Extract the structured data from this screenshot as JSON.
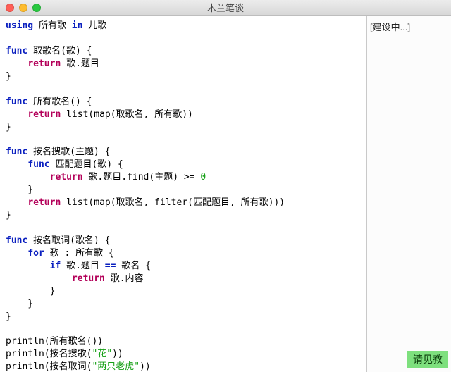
{
  "window": {
    "title": "木兰笔谈"
  },
  "sidebar": {
    "status": "[建设中...]",
    "footer": "请见教"
  },
  "code": {
    "line01_kw_using": "using",
    "line01_mid": " 所有歌 ",
    "line01_kw_in": "in",
    "line01_end": " 儿歌",
    "line03_kw_func": "func",
    "line03_sig": " 取歌名(歌) {",
    "line04_indent": "    ",
    "line04_ret": "return",
    "line04_body": " 歌.题目",
    "line05": "}",
    "line07_kw_func": "func",
    "line07_sig": " 所有歌名() {",
    "line08_indent": "    ",
    "line08_ret": "return",
    "line08_body": " list(map(取歌名, 所有歌))",
    "line09": "}",
    "line11_kw_func": "func",
    "line11_sig": " 按名搜歌(主题) {",
    "line12_indent": "    ",
    "line12_kw_func": "func",
    "line12_sig": " 匹配题目(歌) {",
    "line13_indent": "        ",
    "line13_ret": "return",
    "line13_body": " 歌.题目.find(主题) >= ",
    "line13_num": "0",
    "line14": "    }",
    "line15_indent": "    ",
    "line15_ret": "return",
    "line15_body": " list(map(取歌名, filter(匹配题目, 所有歌)))",
    "line16": "}",
    "line18_kw_func": "func",
    "line18_sig": " 按名取词(歌名) {",
    "line19_indent": "    ",
    "line19_for": "for",
    "line19_body": " 歌 : 所有歌 {",
    "line20_indent": "        ",
    "line20_if": "if",
    "line20_body1": " 歌.题目 ",
    "line20_eq": "==",
    "line20_body2": " 歌名 {",
    "line21_indent": "            ",
    "line21_ret": "return",
    "line21_body": " 歌.内容",
    "line22": "        }",
    "line23": "    }",
    "line24": "}",
    "line26": "println(所有歌名())",
    "line27a": "println(按名搜歌(",
    "line27s": "\"花\"",
    "line27b": "))",
    "line28a": "println(按名取词(",
    "line28s": "\"两只老虎\"",
    "line28b": "))"
  }
}
